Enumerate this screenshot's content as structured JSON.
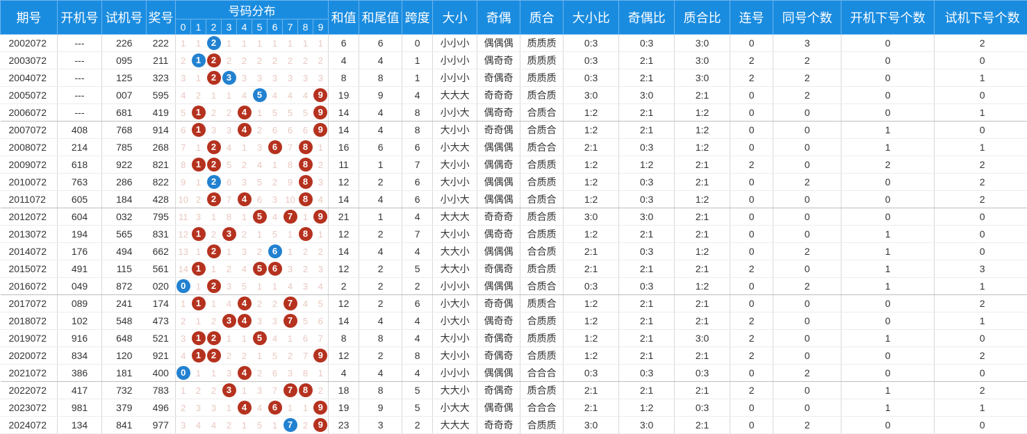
{
  "header": {
    "labels": [
      "期号",
      "开机号",
      "试机号",
      "奖号",
      "号码分布",
      "和值",
      "和尾值",
      "跨度",
      "大小",
      "奇偶",
      "质合",
      "大小比",
      "奇偶比",
      "质合比",
      "连号",
      "同号个数",
      "开机下号个数",
      "试机下号个数"
    ],
    "digits": [
      "0",
      "1",
      "2",
      "3",
      "4",
      "5",
      "6",
      "7",
      "8",
      "9"
    ]
  },
  "colors": {
    "header_bg": "#1a8ce0",
    "ball_red": "#b5321f",
    "ball_blue": "#2281d0",
    "miss_text": "#e9c8c0"
  },
  "rows": [
    {
      "issue": "2002072",
      "kj": "---",
      "sj": "226",
      "jh": "222",
      "dist": [
        "1",
        "1",
        "2",
        "1",
        "1",
        "1",
        "1",
        "1",
        "1",
        "1"
      ],
      "ball": {
        "2": "blue"
      },
      "hz": "6",
      "hw": "6",
      "kd": "0",
      "dx": "小小小",
      "jo": "偶偶偶",
      "zh": "质质质",
      "dxb": "0:3",
      "job": "0:3",
      "zhb": "3:0",
      "lh": "0",
      "th": "3",
      "kjx": "0",
      "sjx": "2"
    },
    {
      "issue": "2003072",
      "kj": "---",
      "sj": "095",
      "jh": "211",
      "dist": [
        "2",
        "1",
        "2",
        "2",
        "2",
        "2",
        "2",
        "2",
        "2",
        "2"
      ],
      "ball": {
        "1": "blue",
        "2": "red"
      },
      "hz": "4",
      "hw": "4",
      "kd": "1",
      "dx": "小小小",
      "jo": "偶奇奇",
      "zh": "质质质",
      "dxb": "0:3",
      "job": "2:1",
      "zhb": "3:0",
      "lh": "2",
      "th": "2",
      "kjx": "0",
      "sjx": "0"
    },
    {
      "issue": "2004072",
      "kj": "---",
      "sj": "125",
      "jh": "323",
      "dist": [
        "3",
        "1",
        "2",
        "3",
        "3",
        "3",
        "3",
        "3",
        "3",
        "3"
      ],
      "ball": {
        "2": "red",
        "3": "blue"
      },
      "hz": "8",
      "hw": "8",
      "kd": "1",
      "dx": "小小小",
      "jo": "奇偶奇",
      "zh": "质质质",
      "dxb": "0:3",
      "job": "2:1",
      "zhb": "3:0",
      "lh": "2",
      "th": "2",
      "kjx": "0",
      "sjx": "1"
    },
    {
      "issue": "2005072",
      "kj": "---",
      "sj": "007",
      "jh": "595",
      "dist": [
        "4",
        "2",
        "1",
        "1",
        "4",
        "5",
        "4",
        "4",
        "4",
        "9"
      ],
      "ball": {
        "5": "blue",
        "9": "red"
      },
      "hz": "19",
      "hw": "9",
      "kd": "4",
      "dx": "大大大",
      "jo": "奇奇奇",
      "zh": "质合质",
      "dxb": "3:0",
      "job": "3:0",
      "zhb": "2:1",
      "lh": "0",
      "th": "2",
      "kjx": "0",
      "sjx": "0"
    },
    {
      "issue": "2006072",
      "kj": "---",
      "sj": "681",
      "jh": "419",
      "dist": [
        "5",
        "1",
        "2",
        "2",
        "4",
        "1",
        "5",
        "5",
        "5",
        "9"
      ],
      "ball": {
        "1": "red",
        "4": "red",
        "9": "red"
      },
      "hz": "14",
      "hw": "4",
      "kd": "8",
      "dx": "小小大",
      "jo": "偶奇奇",
      "zh": "合质合",
      "dxb": "1:2",
      "job": "2:1",
      "zhb": "1:2",
      "lh": "0",
      "th": "0",
      "kjx": "0",
      "sjx": "1"
    },
    {
      "issue": "2007072",
      "kj": "408",
      "sj": "768",
      "jh": "914",
      "dist": [
        "6",
        "1",
        "3",
        "3",
        "4",
        "2",
        "6",
        "6",
        "6",
        "9"
      ],
      "ball": {
        "1": "red",
        "4": "red",
        "9": "red"
      },
      "hz": "14",
      "hw": "4",
      "kd": "8",
      "dx": "大小小",
      "jo": "奇奇偶",
      "zh": "合质合",
      "dxb": "1:2",
      "job": "2:1",
      "zhb": "1:2",
      "lh": "0",
      "th": "0",
      "kjx": "1",
      "sjx": "0"
    },
    {
      "issue": "2008072",
      "kj": "214",
      "sj": "785",
      "jh": "268",
      "dist": [
        "7",
        "1",
        "2",
        "4",
        "1",
        "3",
        "6",
        "7",
        "8",
        "1"
      ],
      "ball": {
        "2": "red",
        "6": "red",
        "8": "red"
      },
      "hz": "16",
      "hw": "6",
      "kd": "6",
      "dx": "小大大",
      "jo": "偶偶偶",
      "zh": "质合合",
      "dxb": "2:1",
      "job": "0:3",
      "zhb": "1:2",
      "lh": "0",
      "th": "0",
      "kjx": "1",
      "sjx": "1"
    },
    {
      "issue": "2009072",
      "kj": "618",
      "sj": "922",
      "jh": "821",
      "dist": [
        "8",
        "1",
        "2",
        "5",
        "2",
        "4",
        "1",
        "8",
        "8",
        "2"
      ],
      "ball": {
        "1": "red",
        "2": "red",
        "8": "red"
      },
      "hz": "11",
      "hw": "1",
      "kd": "7",
      "dx": "大小小",
      "jo": "偶偶奇",
      "zh": "合质质",
      "dxb": "1:2",
      "job": "1:2",
      "zhb": "2:1",
      "lh": "2",
      "th": "0",
      "kjx": "2",
      "sjx": "2"
    },
    {
      "issue": "2010072",
      "kj": "763",
      "sj": "286",
      "jh": "822",
      "dist": [
        "9",
        "1",
        "2",
        "6",
        "3",
        "5",
        "2",
        "9",
        "8",
        "3"
      ],
      "ball": {
        "2": "blue",
        "8": "red"
      },
      "hz": "12",
      "hw": "2",
      "kd": "6",
      "dx": "大小小",
      "jo": "偶偶偶",
      "zh": "合质质",
      "dxb": "1:2",
      "job": "0:3",
      "zhb": "2:1",
      "lh": "0",
      "th": "2",
      "kjx": "0",
      "sjx": "2"
    },
    {
      "issue": "2011072",
      "kj": "605",
      "sj": "184",
      "jh": "428",
      "dist": [
        "10",
        "2",
        "2",
        "7",
        "4",
        "6",
        "3",
        "10",
        "8",
        "4"
      ],
      "ball": {
        "2": "red",
        "4": "red",
        "8": "red"
      },
      "hz": "14",
      "hw": "4",
      "kd": "6",
      "dx": "小小大",
      "jo": "偶偶偶",
      "zh": "合质合",
      "dxb": "1:2",
      "job": "0:3",
      "zhb": "1:2",
      "lh": "0",
      "th": "0",
      "kjx": "0",
      "sjx": "2"
    },
    {
      "issue": "2012072",
      "kj": "604",
      "sj": "032",
      "jh": "795",
      "dist": [
        "11",
        "3",
        "1",
        "8",
        "1",
        "5",
        "4",
        "7",
        "1",
        "9"
      ],
      "ball": {
        "5": "red",
        "7": "red",
        "9": "red"
      },
      "hz": "21",
      "hw": "1",
      "kd": "4",
      "dx": "大大大",
      "jo": "奇奇奇",
      "zh": "质合质",
      "dxb": "3:0",
      "job": "3:0",
      "zhb": "2:1",
      "lh": "0",
      "th": "0",
      "kjx": "0",
      "sjx": "0"
    },
    {
      "issue": "2013072",
      "kj": "194",
      "sj": "565",
      "jh": "831",
      "dist": [
        "12",
        "1",
        "2",
        "3",
        "2",
        "1",
        "5",
        "1",
        "8",
        "1"
      ],
      "ball": {
        "1": "red",
        "3": "red",
        "8": "red"
      },
      "hz": "12",
      "hw": "2",
      "kd": "7",
      "dx": "大小小",
      "jo": "偶奇奇",
      "zh": "合质质",
      "dxb": "1:2",
      "job": "2:1",
      "zhb": "2:1",
      "lh": "0",
      "th": "0",
      "kjx": "1",
      "sjx": "0"
    },
    {
      "issue": "2014072",
      "kj": "176",
      "sj": "494",
      "jh": "662",
      "dist": [
        "13",
        "1",
        "2",
        "1",
        "3",
        "2",
        "6",
        "1",
        "2",
        "2"
      ],
      "ball": {
        "2": "red",
        "6": "blue"
      },
      "hz": "14",
      "hw": "4",
      "kd": "4",
      "dx": "大大小",
      "jo": "偶偶偶",
      "zh": "合合质",
      "dxb": "2:1",
      "job": "0:3",
      "zhb": "1:2",
      "lh": "0",
      "th": "2",
      "kjx": "1",
      "sjx": "0"
    },
    {
      "issue": "2015072",
      "kj": "491",
      "sj": "115",
      "jh": "561",
      "dist": [
        "14",
        "1",
        "1",
        "2",
        "4",
        "5",
        "6",
        "3",
        "2",
        "3"
      ],
      "ball": {
        "1": "red",
        "5": "red",
        "6": "red"
      },
      "hz": "12",
      "hw": "2",
      "kd": "5",
      "dx": "大大小",
      "jo": "奇偶奇",
      "zh": "质合质",
      "dxb": "2:1",
      "job": "2:1",
      "zhb": "2:1",
      "lh": "2",
      "th": "0",
      "kjx": "1",
      "sjx": "3"
    },
    {
      "issue": "2016072",
      "kj": "049",
      "sj": "872",
      "jh": "020",
      "dist": [
        "0",
        "1",
        "2",
        "3",
        "5",
        "1",
        "1",
        "4",
        "3",
        "4"
      ],
      "ball": {
        "0": "blue",
        "2": "red"
      },
      "hz": "2",
      "hw": "2",
      "kd": "2",
      "dx": "小小小",
      "jo": "偶偶偶",
      "zh": "合质合",
      "dxb": "0:3",
      "job": "0:3",
      "zhb": "1:2",
      "lh": "0",
      "th": "2",
      "kjx": "1",
      "sjx": "1"
    },
    {
      "issue": "2017072",
      "kj": "089",
      "sj": "241",
      "jh": "174",
      "dist": [
        "1",
        "1",
        "1",
        "4",
        "4",
        "2",
        "2",
        "7",
        "4",
        "5"
      ],
      "ball": {
        "1": "red",
        "4": "red",
        "7": "red"
      },
      "hz": "12",
      "hw": "2",
      "kd": "6",
      "dx": "小大小",
      "jo": "奇奇偶",
      "zh": "质质合",
      "dxb": "1:2",
      "job": "2:1",
      "zhb": "2:1",
      "lh": "0",
      "th": "0",
      "kjx": "0",
      "sjx": "2"
    },
    {
      "issue": "2018072",
      "kj": "102",
      "sj": "548",
      "jh": "473",
      "dist": [
        "2",
        "1",
        "2",
        "3",
        "4",
        "3",
        "3",
        "7",
        "5",
        "6"
      ],
      "ball": {
        "3": "red",
        "4": "red",
        "7": "red"
      },
      "hz": "14",
      "hw": "4",
      "kd": "4",
      "dx": "小大小",
      "jo": "偶奇奇",
      "zh": "合质质",
      "dxb": "1:2",
      "job": "2:1",
      "zhb": "2:1",
      "lh": "2",
      "th": "0",
      "kjx": "0",
      "sjx": "1"
    },
    {
      "issue": "2019072",
      "kj": "916",
      "sj": "648",
      "jh": "521",
      "dist": [
        "3",
        "1",
        "2",
        "1",
        "1",
        "5",
        "4",
        "1",
        "6",
        "7"
      ],
      "ball": {
        "1": "red",
        "2": "red",
        "5": "red"
      },
      "hz": "8",
      "hw": "8",
      "kd": "4",
      "dx": "大小小",
      "jo": "奇偶奇",
      "zh": "质质质",
      "dxb": "1:2",
      "job": "2:1",
      "zhb": "3:0",
      "lh": "2",
      "th": "0",
      "kjx": "1",
      "sjx": "0"
    },
    {
      "issue": "2020072",
      "kj": "834",
      "sj": "120",
      "jh": "921",
      "dist": [
        "4",
        "1",
        "2",
        "2",
        "2",
        "1",
        "5",
        "2",
        "7",
        "9"
      ],
      "ball": {
        "1": "red",
        "2": "red",
        "9": "red"
      },
      "hz": "12",
      "hw": "2",
      "kd": "8",
      "dx": "大小小",
      "jo": "奇偶奇",
      "zh": "合质质",
      "dxb": "1:2",
      "job": "2:1",
      "zhb": "2:1",
      "lh": "2",
      "th": "0",
      "kjx": "0",
      "sjx": "2"
    },
    {
      "issue": "2021072",
      "kj": "386",
      "sj": "181",
      "jh": "400",
      "dist": [
        "0",
        "1",
        "1",
        "3",
        "4",
        "2",
        "6",
        "3",
        "8",
        "1"
      ],
      "ball": {
        "0": "blue",
        "4": "red"
      },
      "hz": "4",
      "hw": "4",
      "kd": "4",
      "dx": "小小小",
      "jo": "偶偶偶",
      "zh": "合合合",
      "dxb": "0:3",
      "job": "0:3",
      "zhb": "0:3",
      "lh": "0",
      "th": "2",
      "kjx": "0",
      "sjx": "0"
    },
    {
      "issue": "2022072",
      "kj": "417",
      "sj": "732",
      "jh": "783",
      "dist": [
        "1",
        "2",
        "2",
        "3",
        "1",
        "3",
        "7",
        "7",
        "8",
        "2"
      ],
      "ball": {
        "3": "red",
        "7": "red",
        "8": "red"
      },
      "hz": "18",
      "hw": "8",
      "kd": "5",
      "dx": "大大小",
      "jo": "奇偶奇",
      "zh": "质合质",
      "dxb": "2:1",
      "job": "2:1",
      "zhb": "2:1",
      "lh": "2",
      "th": "0",
      "kjx": "1",
      "sjx": "2"
    },
    {
      "issue": "2023072",
      "kj": "981",
      "sj": "379",
      "jh": "496",
      "dist": [
        "2",
        "3",
        "3",
        "1",
        "4",
        "4",
        "6",
        "1",
        "1",
        "9"
      ],
      "ball": {
        "4": "red",
        "6": "red",
        "9": "red"
      },
      "hz": "19",
      "hw": "9",
      "kd": "5",
      "dx": "小大大",
      "jo": "偶奇偶",
      "zh": "合合合",
      "dxb": "2:1",
      "job": "1:2",
      "zhb": "0:3",
      "lh": "0",
      "th": "0",
      "kjx": "1",
      "sjx": "1"
    },
    {
      "issue": "2024072",
      "kj": "134",
      "sj": "841",
      "jh": "977",
      "dist": [
        "3",
        "4",
        "4",
        "2",
        "1",
        "5",
        "1",
        "7",
        "2",
        "9"
      ],
      "ball": {
        "7": "blue",
        "9": "red"
      },
      "hz": "23",
      "hw": "3",
      "kd": "2",
      "dx": "大大大",
      "jo": "奇奇奇",
      "zh": "合质质",
      "dxb": "3:0",
      "job": "3:0",
      "zhb": "2:1",
      "lh": "0",
      "th": "2",
      "kjx": "0",
      "sjx": "0"
    }
  ]
}
